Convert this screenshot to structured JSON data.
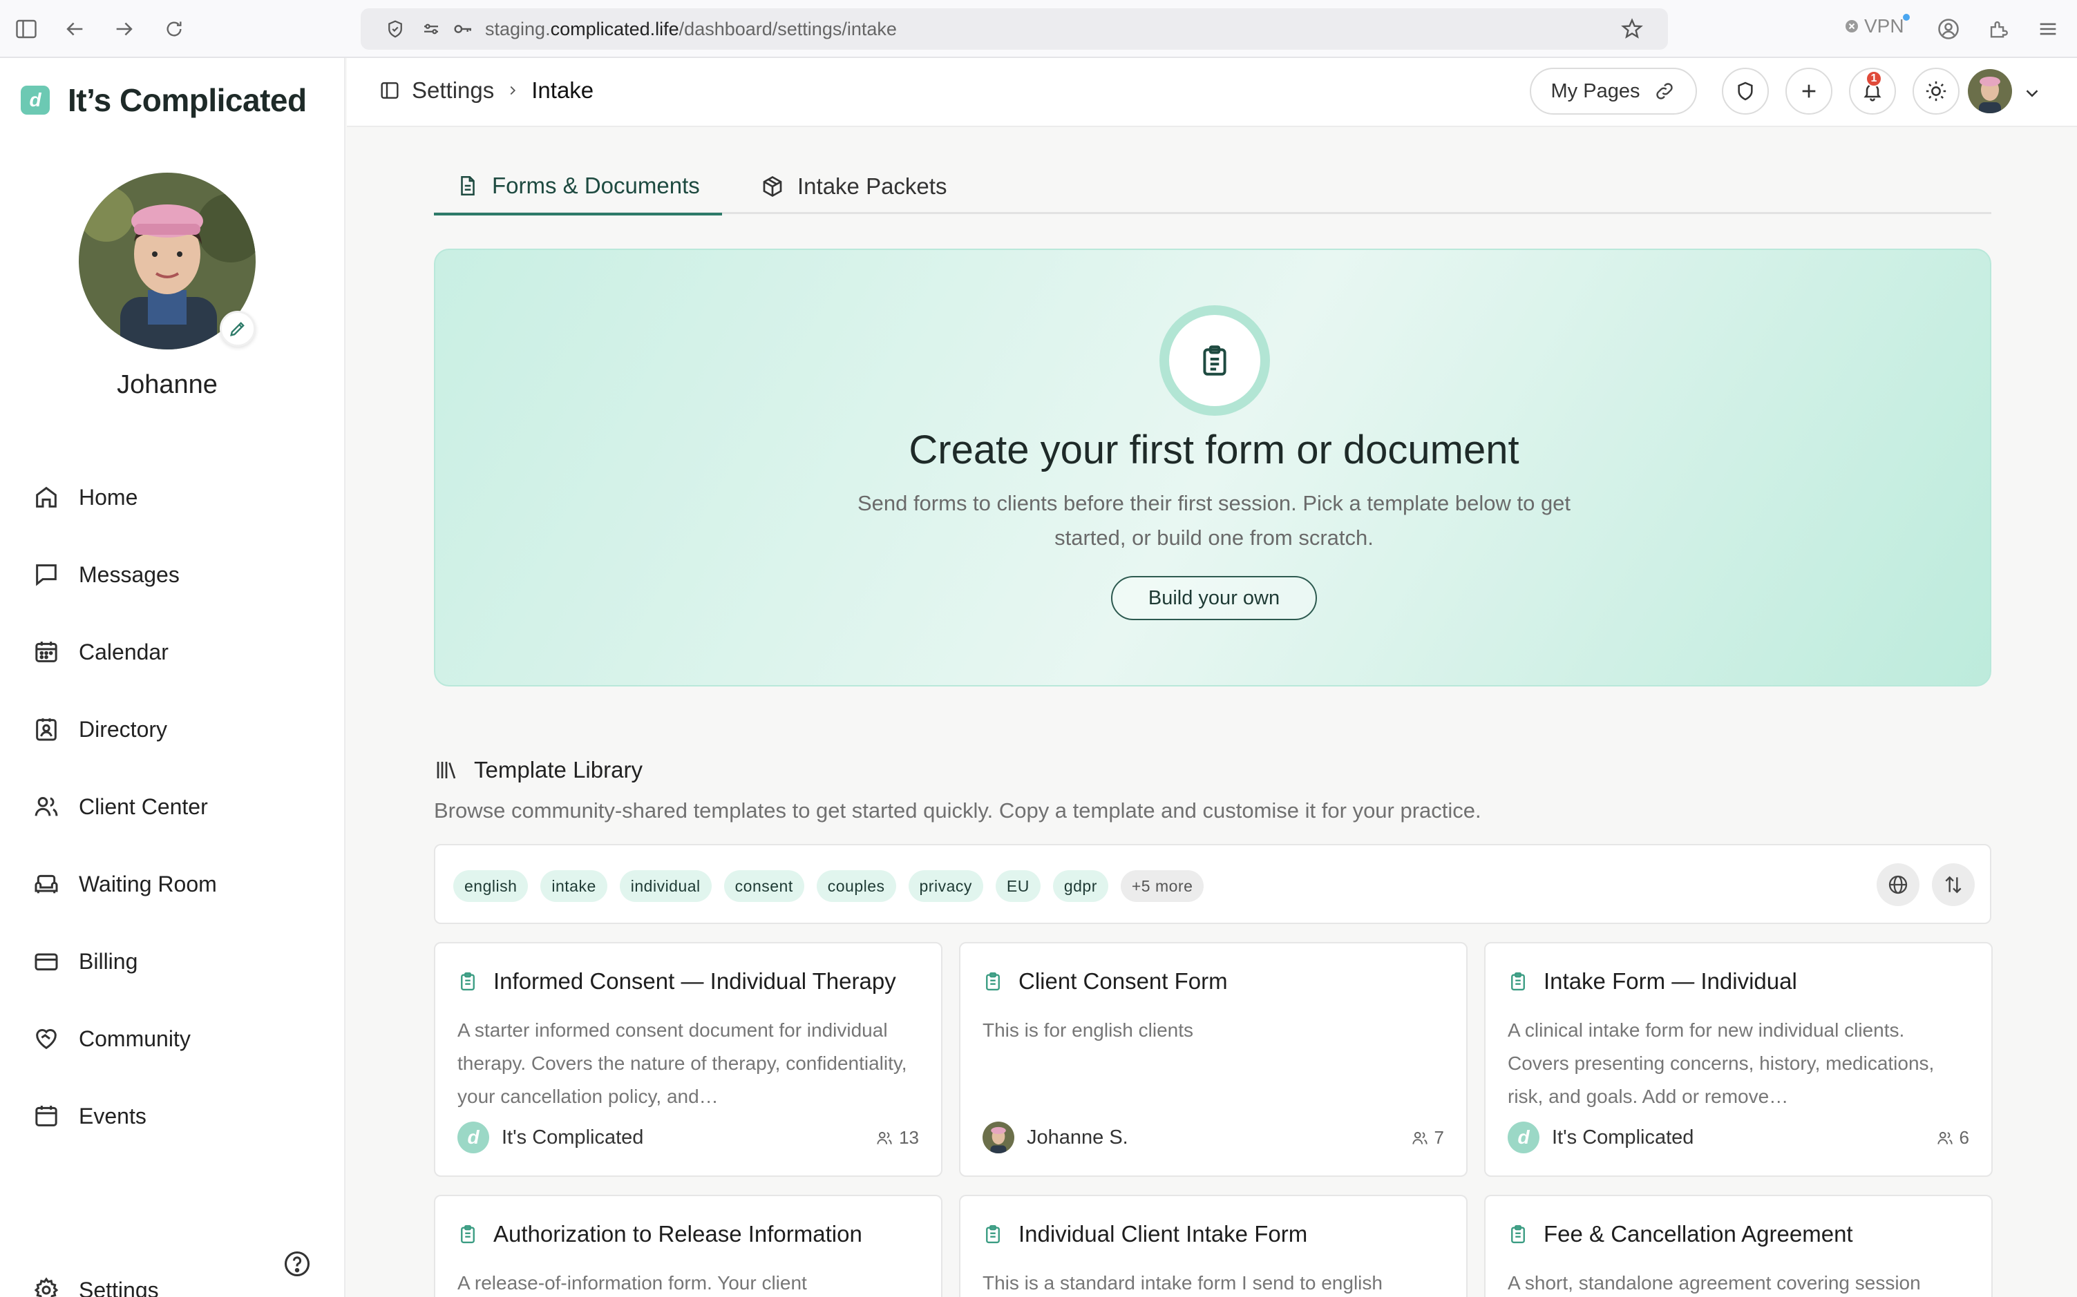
{
  "browser": {
    "url_prefix": "staging.",
    "url_host": "complicated.life",
    "url_path": "/dashboard/settings/intake",
    "vpn_label": "VPN"
  },
  "brand": {
    "logo_letter": "d",
    "name": "It’s Complicated"
  },
  "profile": {
    "name": "Johanne"
  },
  "nav": {
    "items": [
      {
        "label": "Home",
        "icon": "home-icon"
      },
      {
        "label": "Messages",
        "icon": "message-icon"
      },
      {
        "label": "Calendar",
        "icon": "calendar-icon"
      },
      {
        "label": "Directory",
        "icon": "directory-icon"
      },
      {
        "label": "Client Center",
        "icon": "users-icon"
      },
      {
        "label": "Waiting Room",
        "icon": "sofa-icon"
      },
      {
        "label": "Billing",
        "icon": "credit-card-icon"
      },
      {
        "label": "Community",
        "icon": "heart-handshake-icon"
      },
      {
        "label": "Events",
        "icon": "calendar-event-icon"
      }
    ],
    "settings_label": "Settings"
  },
  "topbar": {
    "breadcrumb": [
      "Settings",
      "Intake"
    ],
    "my_pages_label": "My Pages",
    "notification_count": "1"
  },
  "tabs": [
    {
      "label": "Forms & Documents",
      "active": true
    },
    {
      "label": "Intake Packets",
      "active": false
    }
  ],
  "hero": {
    "title": "Create your first form or document",
    "description": "Send forms to clients before their first session. Pick a template below to get started, or build one from scratch.",
    "button_label": "Build your own"
  },
  "library": {
    "title": "Template Library",
    "description": "Browse community-shared templates to get started quickly. Copy a template and customise it for your practice.",
    "tags": [
      "english",
      "intake",
      "individual",
      "consent",
      "couples",
      "privacy",
      "EU",
      "gdpr"
    ],
    "more_tags": "+5 more",
    "cards": [
      {
        "title": "Informed Consent — Individual Therapy",
        "description": "A starter informed consent document for individual therapy. Covers the nature of therapy, confidentiality, your cancellation policy, and…",
        "author": "It's Complicated",
        "author_type": "logo",
        "count": "13"
      },
      {
        "title": "Client Consent Form",
        "description": "This is for english clients",
        "author": "Johanne S.",
        "author_type": "avatar",
        "count": "7"
      },
      {
        "title": "Intake Form — Individual",
        "description": "A clinical intake form for new individual clients. Covers presenting concerns, history, medications, risk, and goals. Add or remove…",
        "author": "It's Complicated",
        "author_type": "logo",
        "count": "6"
      },
      {
        "title": "Authorization to Release Information",
        "description": "A release-of-information form. Your client",
        "author": "",
        "author_type": "",
        "count": ""
      },
      {
        "title": "Individual Client Intake Form",
        "description": "This is a standard intake form I send to english",
        "author": "",
        "author_type": "",
        "count": ""
      },
      {
        "title": "Fee & Cancellation Agreement",
        "description": "A short, standalone agreement covering session",
        "author": "",
        "author_type": "",
        "count": ""
      }
    ]
  },
  "colors": {
    "accent": "#2d7a68",
    "hero_bg": "#c9efe3",
    "tag_bg": "#e1f5ee",
    "badge": "#e04a3a"
  }
}
